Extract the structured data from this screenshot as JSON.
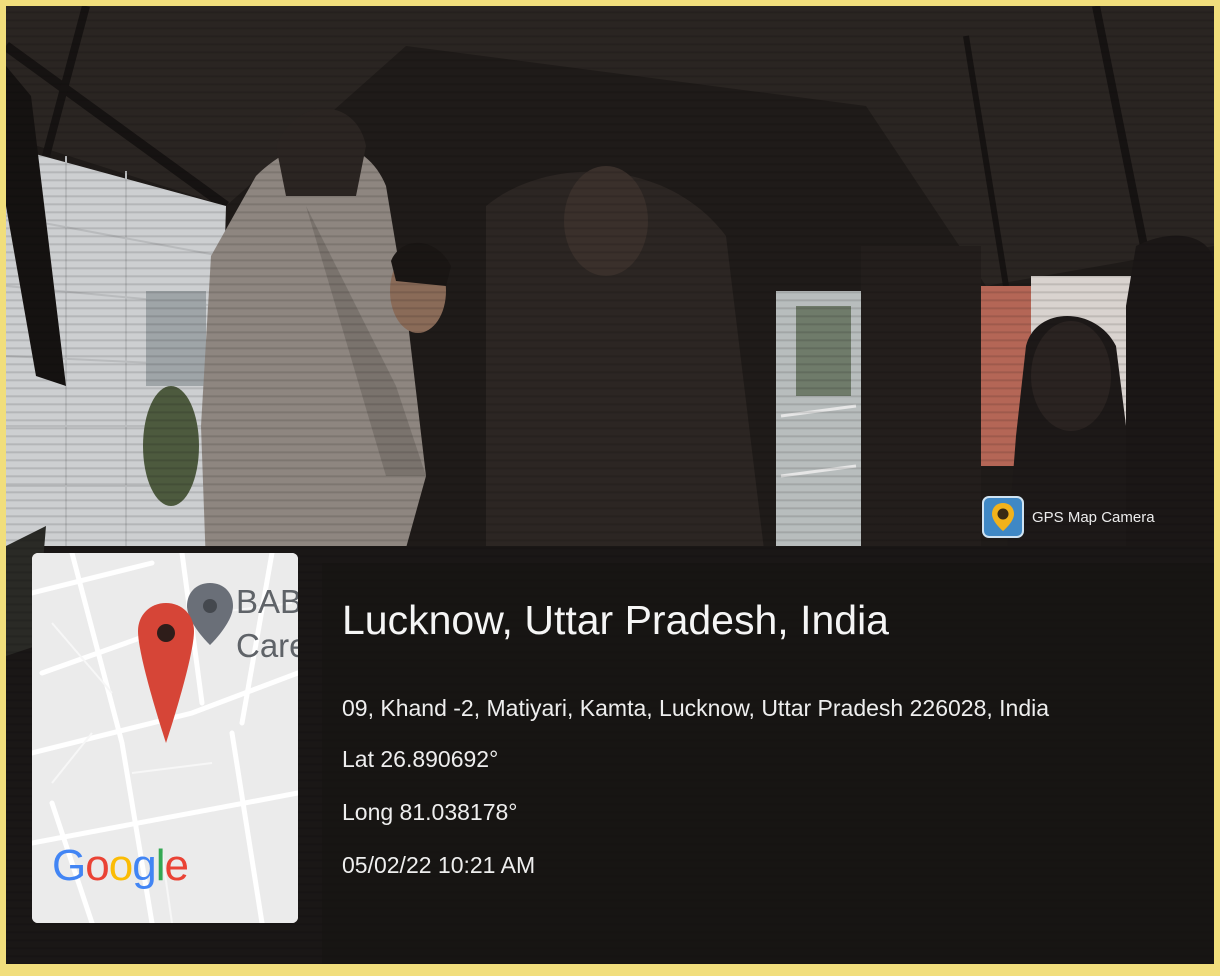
{
  "app_badge": {
    "name": "GPS Map Camera",
    "icon": "gps-map-camera-icon"
  },
  "map": {
    "label_line1": "BAB",
    "label_line2": "Care",
    "provider": "Google",
    "pin_icon": "map-pin-icon",
    "colors": {
      "pin_red": "#d64537",
      "pin_gray": "#6a6f78",
      "map_bg": "#e9e9e9"
    }
  },
  "location": {
    "title": "Lucknow, Uttar Pradesh, India",
    "address": "09, Khand -2, Matiyari, Kamta, Lucknow, Uttar Pradesh 226028, India",
    "latitude": "Lat 26.890692°",
    "longitude": "Long 81.038178°",
    "datetime": "05/02/22 10:21 AM"
  },
  "frame": {
    "border_color": "#f1de7c"
  }
}
